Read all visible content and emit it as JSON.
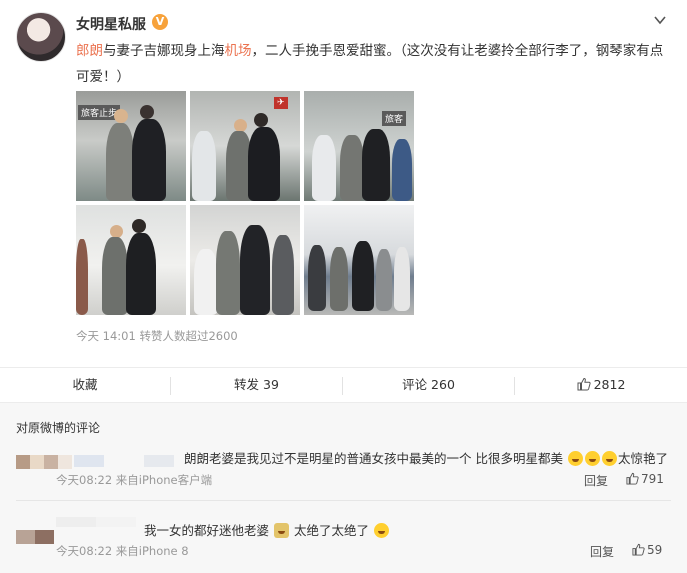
{
  "post": {
    "username": "女明星私服",
    "vip_badge": "V",
    "text_hl_1": "郎朗",
    "text_1": "与妻子吉娜现身上海",
    "text_hl_2": "机场",
    "text_2": "，二人手挽手恩爱甜蜜。（这次没有让老婆拎全部行李了，钢琴家有点可爱！）",
    "timestamp": "今天 14:01 转赞人数超过2600",
    "sign_text": "旅客止步"
  },
  "actions": {
    "collect": "收藏",
    "repost": "转发 39",
    "comment": "评论 260",
    "like": "2812"
  },
  "comments": {
    "header": "对原微博的评论",
    "items": [
      {
        "text_a": "朗朗老婆是我见过不是明星的普通女孩中最美的一个 比很多明星都美",
        "text_b": "太惊艳了",
        "meta": "今天08:22 来自iPhone客户端",
        "reply": "回复",
        "likes": "791"
      },
      {
        "text_a": "我一女的都好迷他老婆",
        "text_b": "太绝了太绝了",
        "meta": "今天08:22 来自iPhone 8",
        "reply": "回复",
        "likes": "59"
      }
    ]
  },
  "colors": {
    "accent": "#eb7350",
    "badge": "#f7a23b",
    "muted": "#999999"
  }
}
